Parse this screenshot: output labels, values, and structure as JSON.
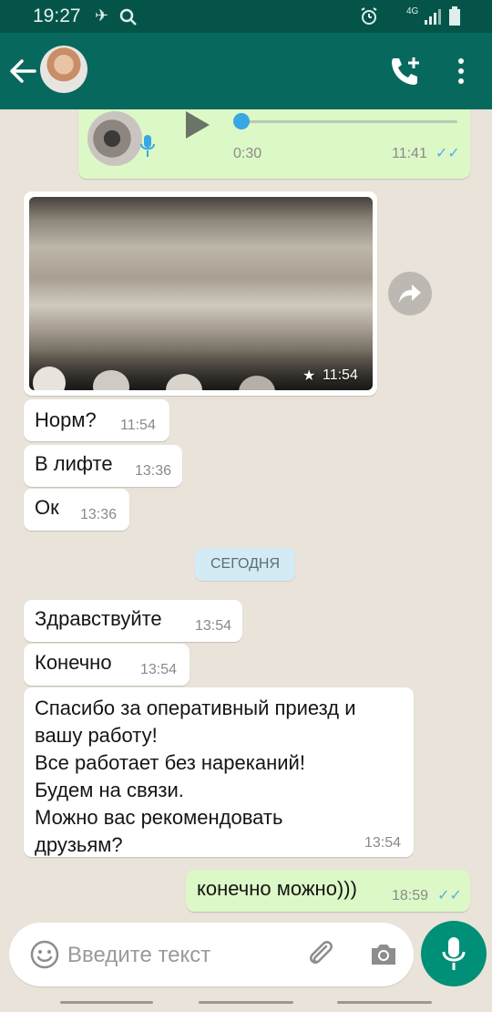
{
  "status_bar": {
    "time": "19:27",
    "network": "4G"
  },
  "header": {
    "avatar": "contact-avatar",
    "icons": [
      "back-arrow-icon",
      "add-call-icon",
      "more-options-icon"
    ]
  },
  "voice_message": {
    "duration": "0:30",
    "time": "11:41",
    "progress": 0.05
  },
  "photo_message": {
    "time": "11:54",
    "starred": true
  },
  "messages": [
    {
      "text": "Норм?",
      "time": "11:54"
    },
    {
      "text": "В лифте",
      "time": "13:36"
    },
    {
      "text": "Ок",
      "time": "13:36"
    }
  ],
  "date_divider": "СЕГОДНЯ",
  "messages_today": [
    {
      "text": "Здравствуйте",
      "time": "13:54"
    },
    {
      "text": "Конечно",
      "time": "13:54"
    },
    {
      "lines": [
        "Спасибо за оперативный приезд и",
        "вашу работу!",
        "Все работает без нареканий!",
        "Будем на связи.",
        "Можно вас рекомендовать",
        "друзьям?"
      ],
      "time": "13:54"
    }
  ],
  "outgoing_message": {
    "text": "конечно можно)))",
    "time": "18:59"
  },
  "composer": {
    "placeholder": "Введите текст"
  },
  "colors": {
    "header": "#07695d",
    "status_bar": "#05544a",
    "outgoing_bubble": "#dcf8c6",
    "read_ticks": "#4fb3ea",
    "mic_button": "#008f77",
    "date_chip": "#d4eaf4"
  }
}
